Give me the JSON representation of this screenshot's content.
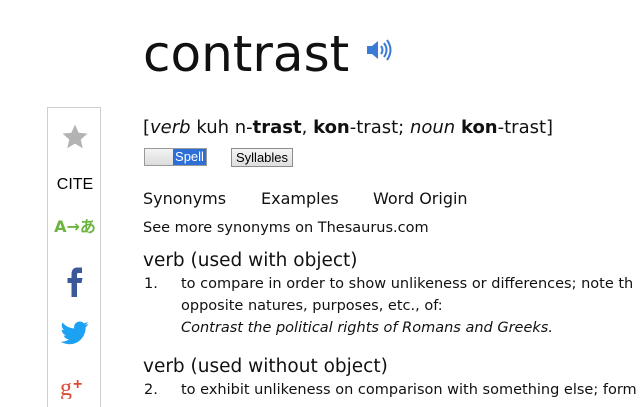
{
  "entry": {
    "headword": "contrast",
    "pronunciation": {
      "open_bracket": "[",
      "pos1": "verb",
      "p1a": "kuh",
      "p1b": "n-",
      "p1c": "trast",
      "comma1": ",",
      "p2a": "kon",
      "p2b": "-trast;",
      "pos2": "noun",
      "p3a": "kon",
      "p3b": "-trast",
      "close_bracket": "]"
    },
    "spell_toggle_label": "Spell",
    "syllables_label": "Syllables"
  },
  "sidebar": {
    "cite_label": "CITE",
    "translate_label": "A→あ"
  },
  "tabs": [
    "Synonyms",
    "Examples",
    "Word Origin"
  ],
  "thesaurus_link": "See more synonyms on Thesaurus.com",
  "sections": [
    {
      "pos_label": "verb (used with object)",
      "number": "1.",
      "lines": [
        "to compare in order to show unlikeness or differences; note th",
        "opposite natures, purposes, etc., of:"
      ],
      "example": "Contrast the political rights of Romans and Greeks."
    },
    {
      "pos_label": "verb (used without object)",
      "number": "2.",
      "lines": [
        "to exhibit unlikeness on comparison with something else; form"
      ]
    }
  ],
  "colors": {
    "accent_blue": "#2d6fd6",
    "facebook": "#3b5998",
    "twitter": "#1da1f2",
    "google_plus": "#dd4b39",
    "translate_green": "#6db33f",
    "star_gray": "#b3b3b3"
  }
}
